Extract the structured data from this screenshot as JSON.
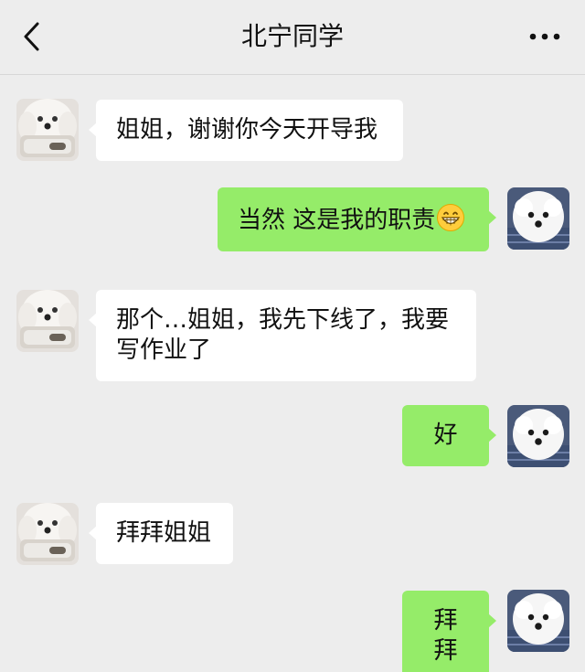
{
  "header": {
    "title": "北宁同学",
    "back_icon": "chevron-left-icon",
    "more_icon": "more-dots-icon"
  },
  "colors": {
    "background": "#ededed",
    "bubble_sent": "#95ec69",
    "bubble_received": "#ffffff",
    "text": "#111111"
  },
  "messages": [
    {
      "side": "left",
      "text": "姐姐，谢谢你今天开导我"
    },
    {
      "side": "right",
      "text": "当然 这是我的职责",
      "emoji": "grinning-face-icon"
    },
    {
      "side": "left",
      "text": "那个…姐姐，我先下线了，我要写作业了"
    },
    {
      "side": "right",
      "text": "好"
    },
    {
      "side": "left",
      "text": "拜拜姐姐"
    },
    {
      "side": "right",
      "text": "拜拜"
    }
  ]
}
